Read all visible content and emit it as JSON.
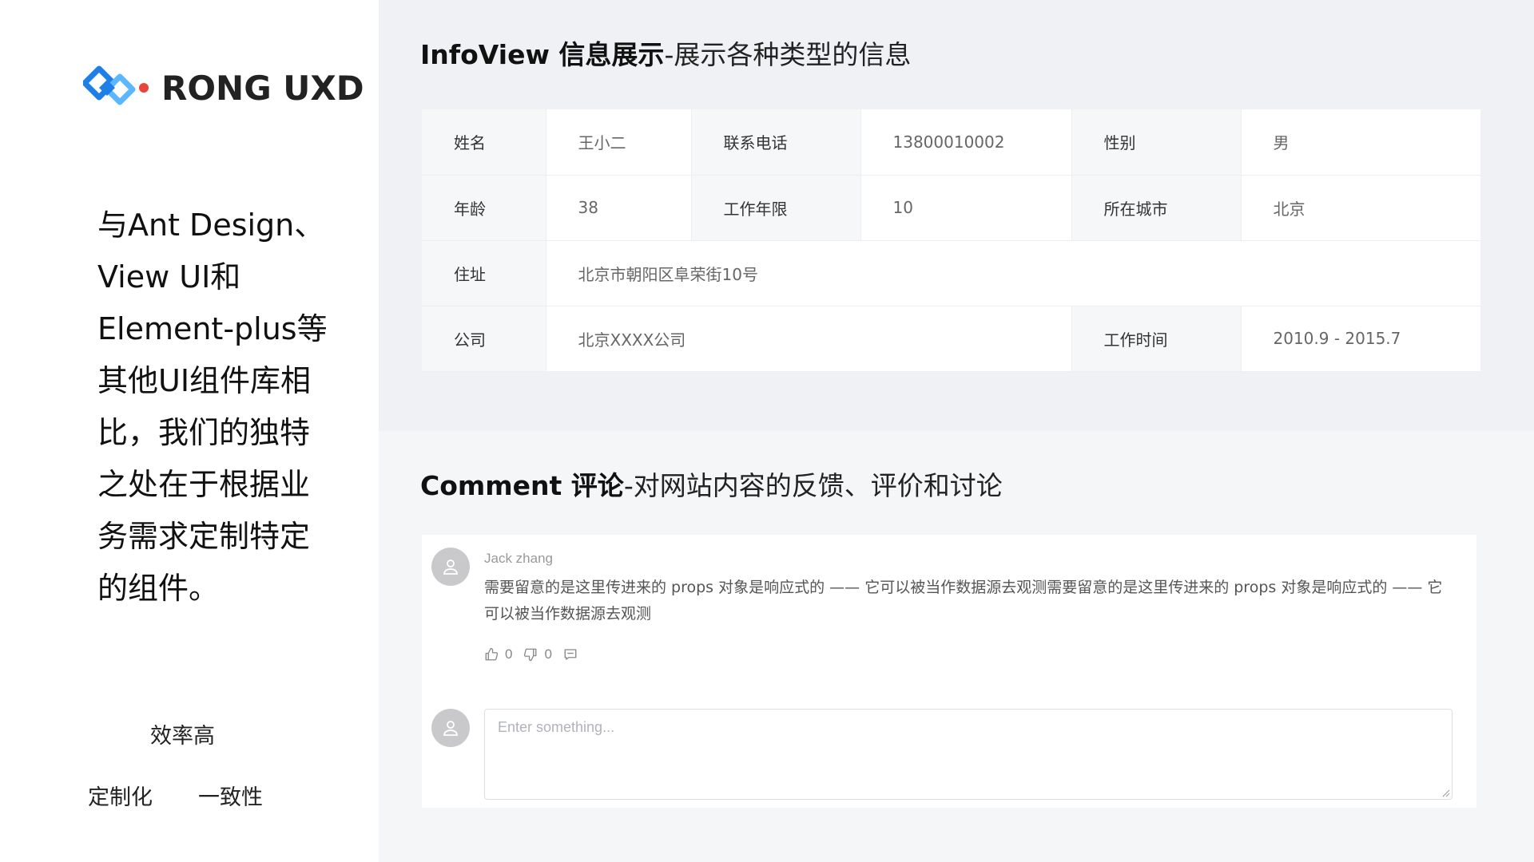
{
  "brand": {
    "logo_text": "RONG UXD",
    "colors": {
      "primary": "#1e7fe6",
      "light": "#5bb8ff",
      "dot": "#e8443a"
    }
  },
  "intro": {
    "lines": [
      "与Ant Design、",
      "View UI和",
      "Element-plus等",
      "其他UI组件库相",
      "比，我们的独特",
      "之处在于根据业",
      "务需求定制特定",
      "的组件。"
    ]
  },
  "tags": {
    "efficiency": "效率高",
    "custom": "定制化",
    "consistent": "一致性"
  },
  "info_section": {
    "title_strong": "InfoView 信息展示",
    "title_light": "-展示各种类型的信息",
    "rows": [
      [
        {
          "label": "姓名"
        },
        {
          "value": "王小二"
        },
        {
          "label": "联系电话"
        },
        {
          "value": "13800010002"
        },
        {
          "label": "性别"
        },
        {
          "value": "男"
        }
      ],
      [
        {
          "label": "年龄"
        },
        {
          "value": "38"
        },
        {
          "label": "工作年限"
        },
        {
          "value": "10"
        },
        {
          "label": "所在城市"
        },
        {
          "value": "北京"
        }
      ],
      [
        {
          "label": "住址"
        },
        {
          "value": "北京市朝阳区阜荣街10号",
          "span": 5
        }
      ],
      [
        {
          "label": "公司"
        },
        {
          "value": "北京XXXX公司",
          "span": 3
        },
        {
          "label": "工作时间"
        },
        {
          "value": "2010.9 - 2015.7"
        }
      ]
    ]
  },
  "comment_section": {
    "title_strong": "Comment 评论",
    "title_light": "-对网站内容的反馈、评价和讨论",
    "comment": {
      "author": "Jack zhang",
      "text": " 需要留意的是这里传进来的 props 对象是响应式的 —— 它可以被当作数据源去观测需要留意的是这里传进来的 props 对象是响应式的 —— 它可以被当作数据源去观测",
      "likes": "0",
      "dislikes": "0"
    },
    "reply": {
      "placeholder": "Enter something..."
    }
  }
}
